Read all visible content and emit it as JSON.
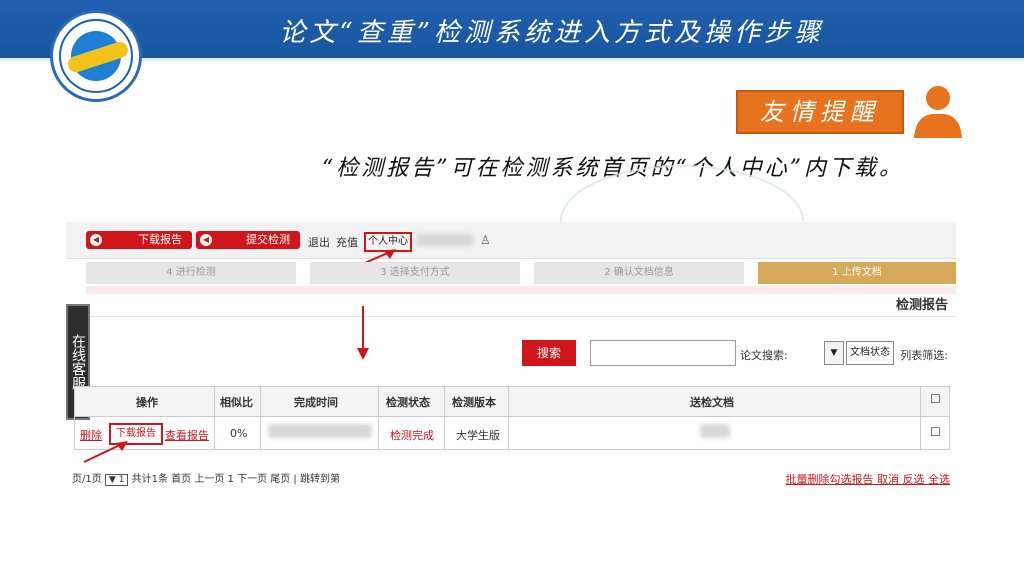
{
  "slide": {
    "title": "论文“查重”检测系统进入方式及操作步骤",
    "reminder": "友情提醒",
    "instruction": "“检测报告”可在检测系统首页的“个人中心”内下载。"
  },
  "topbar": {
    "download_report": "下载报告",
    "submit_check": "提交检测",
    "logout": "退出",
    "recharge": "充值",
    "personal_center": "个人中心"
  },
  "steps": [
    {
      "num": "1",
      "label": "上传文档",
      "active": true
    },
    {
      "num": "2",
      "label": "确认文档信息"
    },
    {
      "num": "3",
      "label": "选择支付方式"
    },
    {
      "num": "4",
      "label": "进行检测"
    }
  ],
  "section_title": "检测报告",
  "side_tab": "在线客服",
  "filter": {
    "label": "列表筛选:",
    "selected": "文档状态",
    "search_label": "论文搜索:",
    "search_button": "搜索"
  },
  "table": {
    "headers": [
      "送检文档",
      "检测版本",
      "检测状态",
      "完成时间",
      "相似比",
      "操作"
    ],
    "row": {
      "version": "大学生版",
      "status": "检测完成",
      "similarity": "0%",
      "ops": [
        "查看报告",
        "下载报告",
        "删除"
      ]
    }
  },
  "footer": {
    "pager": "共计1条 首页 上一页 1 下一页 尾页 | 跳转到第",
    "page_value": "1",
    "page_suffix": "页/1页",
    "bulk": [
      "全选",
      "反选",
      "取消",
      "批量删除勾选报告"
    ]
  },
  "colors": {
    "banner": "#1f5fae",
    "accent": "#d0161b",
    "reminder": "#e8731e",
    "active_step": "#d9a95a"
  }
}
